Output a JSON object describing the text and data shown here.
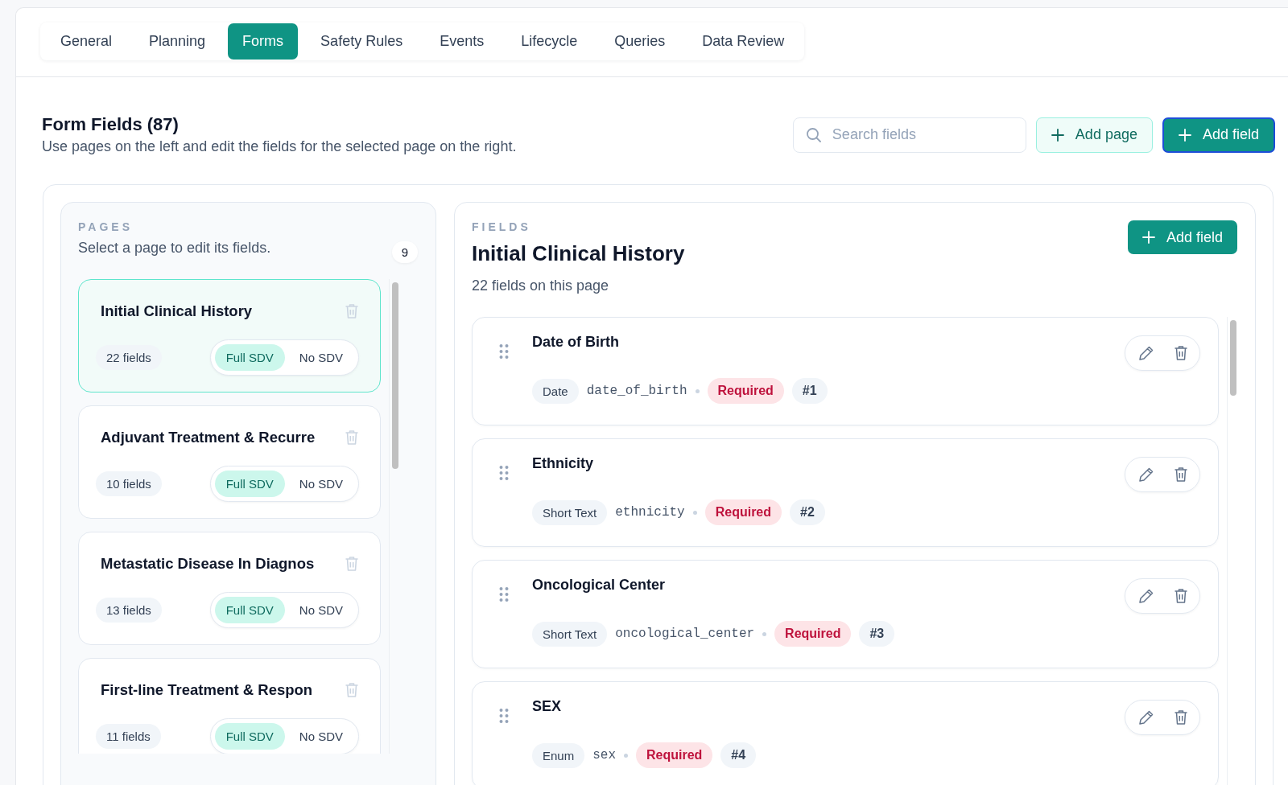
{
  "tabs": [
    {
      "label": "General",
      "selected": false
    },
    {
      "label": "Planning",
      "selected": false
    },
    {
      "label": "Forms",
      "selected": true
    },
    {
      "label": "Safety Rules",
      "selected": false
    },
    {
      "label": "Events",
      "selected": false
    },
    {
      "label": "Lifecycle",
      "selected": false
    },
    {
      "label": "Queries",
      "selected": false
    },
    {
      "label": "Data Review",
      "selected": false
    }
  ],
  "header": {
    "title": "Form Fields (87)",
    "subtitle": "Use pages on the left and edit the fields for the selected page on the right."
  },
  "search": {
    "placeholder": "Search fields"
  },
  "actions": [
    {
      "label": "Add page",
      "kind": "secondary"
    },
    {
      "label": "Add field",
      "kind": "primary"
    }
  ],
  "pages_panel": {
    "heading": "PAGES",
    "hint": "Select a page to edit its fields.",
    "count": "9",
    "pages": [
      {
        "title": "Initial Clinical History",
        "fields": "22 fields",
        "selected": true,
        "sdv": [
          {
            "label": "Full SDV",
            "selected": true
          },
          {
            "label": "No SDV",
            "selected": false
          }
        ]
      },
      {
        "title": "Adjuvant Treatment & Recurre",
        "fields": "10 fields",
        "selected": false,
        "sdv": [
          {
            "label": "Full SDV",
            "selected": true
          },
          {
            "label": "No SDV",
            "selected": false
          }
        ]
      },
      {
        "title": "Metastatic Disease In Diagnos",
        "fields": "13 fields",
        "selected": false,
        "sdv": [
          {
            "label": "Full SDV",
            "selected": true
          },
          {
            "label": "No SDV",
            "selected": false
          }
        ]
      },
      {
        "title": "First-line Treatment & Respon",
        "fields": "11 fields",
        "selected": false,
        "sdv": [
          {
            "label": "Full SDV",
            "selected": true
          },
          {
            "label": "No SDV",
            "selected": false
          }
        ]
      }
    ]
  },
  "fields_panel": {
    "heading": "FIELDS",
    "title": "Initial Clinical History",
    "subtitle": "22 fields on this page",
    "add_button": "Add field",
    "fields": [
      {
        "name": "Date of Birth",
        "type": "Date",
        "key": "date_of_birth",
        "badge": "Required",
        "number": "#1"
      },
      {
        "name": "Ethnicity",
        "type": "Short Text",
        "key": "ethnicity",
        "badge": "Required",
        "number": "#2"
      },
      {
        "name": "Oncological Center",
        "type": "Short Text",
        "key": "oncological_center",
        "badge": "Required",
        "number": "#3"
      },
      {
        "name": "SEX",
        "type": "Enum",
        "key": "sex",
        "badge": "Required",
        "number": "#4"
      }
    ]
  }
}
